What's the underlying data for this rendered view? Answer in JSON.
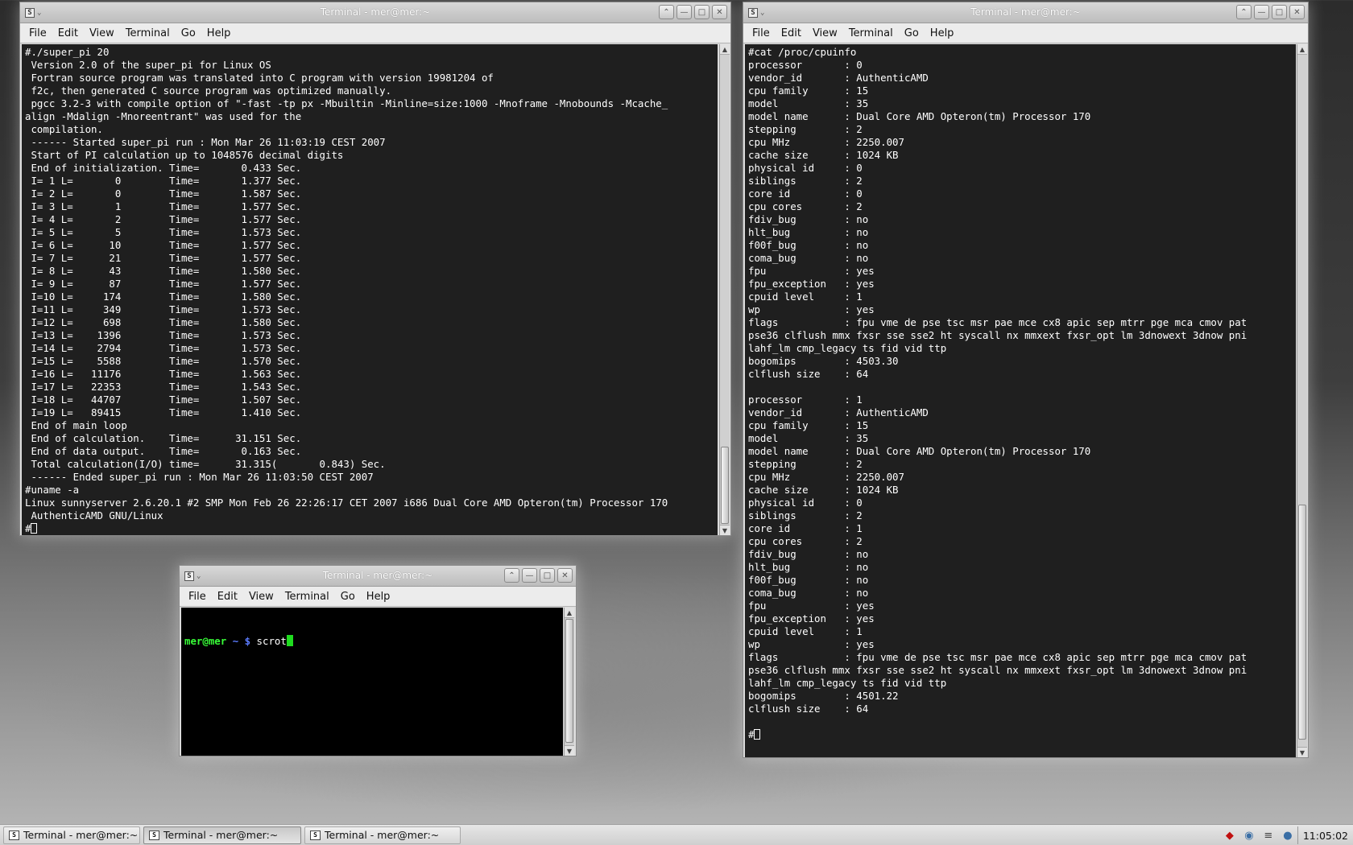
{
  "windows": {
    "left": {
      "title": "Terminal - mer@mer:~",
      "menu": [
        "File",
        "Edit",
        "View",
        "Terminal",
        "Go",
        "Help"
      ],
      "lines": [
        "#./super_pi 20",
        " Version 2.0 of the super_pi for Linux OS",
        " Fortran source program was translated into C program with version 19981204 of",
        " f2c, then generated C source program was optimized manually.",
        " pgcc 3.2-3 with compile option of \"-fast -tp px -Mbuiltin -Minline=size:1000 -Mnoframe -Mnobounds -Mcache_",
        "align -Mdalign -Mnoreentrant\" was used for the",
        " compilation.",
        " ------ Started super_pi run : Mon Mar 26 11:03:19 CEST 2007",
        " Start of PI calculation up to 1048576 decimal digits",
        " End of initialization. Time=       0.433 Sec.",
        " I= 1 L=       0        Time=       1.377 Sec.",
        " I= 2 L=       0        Time=       1.587 Sec.",
        " I= 3 L=       1        Time=       1.577 Sec.",
        " I= 4 L=       2        Time=       1.577 Sec.",
        " I= 5 L=       5        Time=       1.573 Sec.",
        " I= 6 L=      10        Time=       1.577 Sec.",
        " I= 7 L=      21        Time=       1.577 Sec.",
        " I= 8 L=      43        Time=       1.580 Sec.",
        " I= 9 L=      87        Time=       1.577 Sec.",
        " I=10 L=     174        Time=       1.580 Sec.",
        " I=11 L=     349        Time=       1.573 Sec.",
        " I=12 L=     698        Time=       1.580 Sec.",
        " I=13 L=    1396        Time=       1.573 Sec.",
        " I=14 L=    2794        Time=       1.573 Sec.",
        " I=15 L=    5588        Time=       1.570 Sec.",
        " I=16 L=   11176        Time=       1.563 Sec.",
        " I=17 L=   22353        Time=       1.543 Sec.",
        " I=18 L=   44707        Time=       1.507 Sec.",
        " I=19 L=   89415        Time=       1.410 Sec.",
        " End of main loop",
        " End of calculation.    Time=      31.151 Sec.",
        " End of data output.    Time=       0.163 Sec.",
        " Total calculation(I/O) time=      31.315(       0.843) Sec.",
        " ------ Ended super_pi run : Mon Mar 26 11:03:50 CEST 2007",
        "#uname -a",
        "Linux sunnyserver 2.6.20.1 #2 SMP Mon Feb 26 22:26:17 CET 2007 i686 Dual Core AMD Opteron(tm) Processor 170",
        " AuthenticAMD GNU/Linux"
      ],
      "prompt": "#"
    },
    "right": {
      "title": "Terminal - mer@mer:~",
      "menu": [
        "File",
        "Edit",
        "View",
        "Terminal",
        "Go",
        "Help"
      ],
      "lines": [
        "#cat /proc/cpuinfo",
        "processor       : 0",
        "vendor_id       : AuthenticAMD",
        "cpu family      : 15",
        "model           : 35",
        "model name      : Dual Core AMD Opteron(tm) Processor 170",
        "stepping        : 2",
        "cpu MHz         : 2250.007",
        "cache size      : 1024 KB",
        "physical id     : 0",
        "siblings        : 2",
        "core id         : 0",
        "cpu cores       : 2",
        "fdiv_bug        : no",
        "hlt_bug         : no",
        "f00f_bug        : no",
        "coma_bug        : no",
        "fpu             : yes",
        "fpu_exception   : yes",
        "cpuid level     : 1",
        "wp              : yes",
        "flags           : fpu vme de pse tsc msr pae mce cx8 apic sep mtrr pge mca cmov pat",
        "pse36 clflush mmx fxsr sse sse2 ht syscall nx mmxext fxsr_opt lm 3dnowext 3dnow pni",
        "lahf_lm cmp_legacy ts fid vid ttp",
        "bogomips        : 4503.30",
        "clflush size    : 64",
        "",
        "processor       : 1",
        "vendor_id       : AuthenticAMD",
        "cpu family      : 15",
        "model           : 35",
        "model name      : Dual Core AMD Opteron(tm) Processor 170",
        "stepping        : 2",
        "cpu MHz         : 2250.007",
        "cache size      : 1024 KB",
        "physical id     : 0",
        "siblings        : 2",
        "core id         : 1",
        "cpu cores       : 2",
        "fdiv_bug        : no",
        "hlt_bug         : no",
        "f00f_bug        : no",
        "coma_bug        : no",
        "fpu             : yes",
        "fpu_exception   : yes",
        "cpuid level     : 1",
        "wp              : yes",
        "flags           : fpu vme de pse tsc msr pae mce cx8 apic sep mtrr pge mca cmov pat",
        "pse36 clflush mmx fxsr sse sse2 ht syscall nx mmxext fxsr_opt lm 3dnowext 3dnow pni",
        "lahf_lm cmp_legacy ts fid vid ttp",
        "bogomips        : 4501.22",
        "clflush size    : 64",
        ""
      ],
      "prompt": "#"
    },
    "small": {
      "title": "Terminal - mer@mer:~",
      "menu": [
        "File",
        "Edit",
        "View",
        "Terminal",
        "Go",
        "Help"
      ],
      "prompt_user": "mer@mer",
      "prompt_path": "~ $",
      "command": "scrot"
    }
  },
  "taskbar": {
    "tasks": [
      "Terminal - mer@mer:~",
      "Terminal - mer@mer:~",
      "Terminal - mer@mer:~"
    ],
    "active_index": 1,
    "clock": "11:05:02"
  },
  "colors": {
    "prompt_user": "#38ff38",
    "prompt_path": "#5c7cff",
    "cursor": "#1fdc1f"
  }
}
